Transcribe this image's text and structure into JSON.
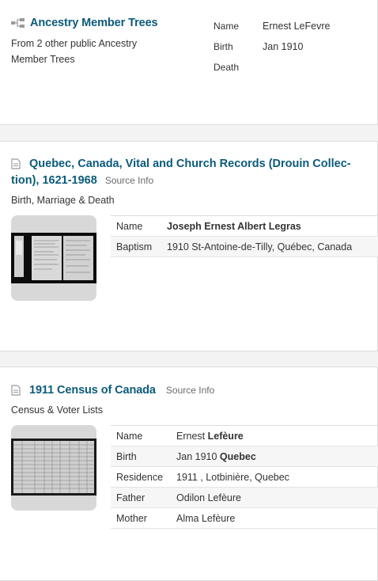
{
  "tree_card": {
    "title": "Ancestry Member Trees",
    "subtitle_line1": "From 2 other public Ancestry",
    "subtitle_line2": "Member Trees",
    "fields": [
      {
        "label": "Name",
        "value": "Ernest LeFevre"
      },
      {
        "label": "Birth",
        "value": "Jan 1910"
      },
      {
        "label": "Death",
        "value": ""
      }
    ]
  },
  "drouin_card": {
    "title_line1": "Quebec, Canada, Vital and Church Records (Drouin Collec-",
    "title_line2": "tion), 1621-1968",
    "source_info": "Source Info",
    "category": "Birth, Marriage & Death",
    "rows": [
      {
        "label": "Name",
        "value": "Joseph Ernest Albert Legras"
      },
      {
        "label": "Baptism",
        "value": "1910 St-Antoine-de-Tilly, Québec, Canada"
      }
    ]
  },
  "census_card": {
    "title": "1911 Census of Canada",
    "source_info": "Source Info",
    "category": "Census & Voter Lists",
    "rows": [
      {
        "label": "Name",
        "value_plain": "Ernest ",
        "value_bold": "Lefèure"
      },
      {
        "label": "Birth",
        "value_plain": "Jan 1910 ",
        "value_bold": "Quebec"
      },
      {
        "label": "Residence",
        "value_plain": "1911 , Lotbinière, Quebec",
        "value_bold": ""
      },
      {
        "label": "Father",
        "value_plain": "Odilon Lefèure",
        "value_bold": ""
      },
      {
        "label": "Mother",
        "value_plain": "Alma Lefèure",
        "value_bold": ""
      }
    ]
  },
  "colors": {
    "title_blue": "#0b5b7a",
    "separator_gray": "#f3f3f3",
    "thumb_bg": "#d8d8d8"
  }
}
